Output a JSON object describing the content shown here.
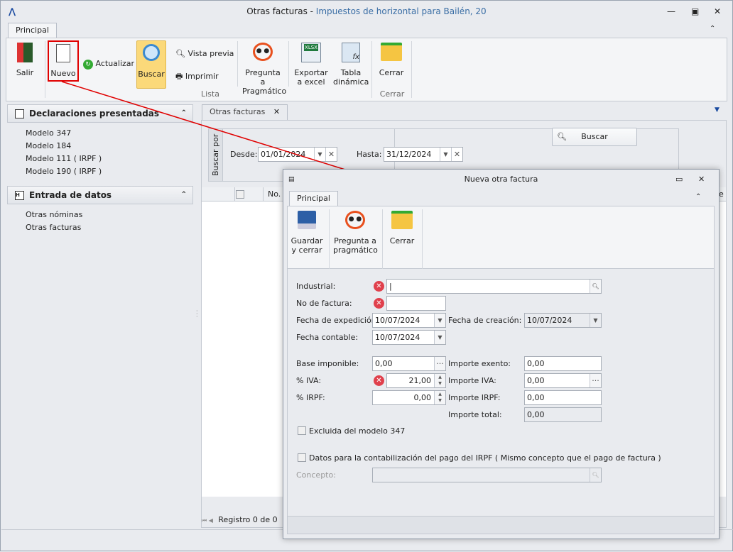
{
  "window": {
    "title": "Otras facturas",
    "title_sep": " - ",
    "subtitle": "Impuestos de horizontal para Bailén, 20"
  },
  "ribbon": {
    "tab": "Principal",
    "salir": "Salir",
    "nuevo": "Nuevo",
    "actualizar": "Actualizar",
    "buscar": "Buscar",
    "vista_previa": "Vista previa",
    "imprimir": "Imprimir",
    "pregunta1": "Pregunta a",
    "pregunta2": "Pragmático",
    "exportar1": "Exportar",
    "exportar2": "a excel",
    "tabla1": "Tabla",
    "tabla2": "dinámica",
    "cerrar": "Cerrar",
    "group_lista": "Lista",
    "group_cerrar": "Cerrar"
  },
  "sidebar": {
    "section1": "Declaraciones presentadas",
    "items1": [
      "Modelo 347",
      "Modelo 184",
      "Modelo 111 ( IRPF )",
      "Modelo 190 ( IRPF )"
    ],
    "section2": "Entrada de datos",
    "items2": [
      "Otras nóminas",
      "Otras facturas"
    ]
  },
  "main": {
    "tab": "Otras facturas",
    "buscar_por": "Buscar por",
    "desde_label": "Desde:",
    "desde": "01/01/2024",
    "hasta_label": "Hasta:",
    "hasta": "31/12/2024",
    "buscar_btn": "Buscar",
    "col_no": "No.",
    "col_e": "e",
    "registro": "Registro 0 de 0"
  },
  "dialog": {
    "title": "Nueva otra factura",
    "tab": "Principal",
    "guardar1": "Guardar",
    "guardar2": "y cerrar",
    "pregunta1": "Pregunta a",
    "pregunta2": "pragmático",
    "cerrar": "Cerrar",
    "industrial": "Industrial:",
    "no_factura": "No de factura:",
    "fecha_exp": "Fecha de expedición:",
    "fecha_exp_val": "10/07/2024",
    "fecha_cre": "Fecha de creación:",
    "fecha_cre_val": "10/07/2024",
    "fecha_cont": "Fecha contable:",
    "fecha_cont_val": "10/07/2024",
    "base": "Base imponible:",
    "base_val": "0,00",
    "exento": "Importe exento:",
    "exento_val": "0,00",
    "iva": "% IVA:",
    "iva_val": "21,00",
    "imp_iva": "Importe IVA:",
    "imp_iva_val": "0,00",
    "irpf": "% IRPF:",
    "irpf_val": "0,00",
    "imp_irpf": "Importe IRPF:",
    "imp_irpf_val": "0,00",
    "total": "Importe total:",
    "total_val": "0,00",
    "excluida": "Excluida del modelo 347",
    "datos_irpf": "Datos para la contabilización del pago del IRPF ( Mismo concepto que el pago de factura )",
    "concepto": "Concepto:"
  },
  "colors": {
    "accent": "#3a6ea5",
    "highlight": "#e00000",
    "buscar_active": "#fbd97a",
    "error": "#e0404c"
  }
}
